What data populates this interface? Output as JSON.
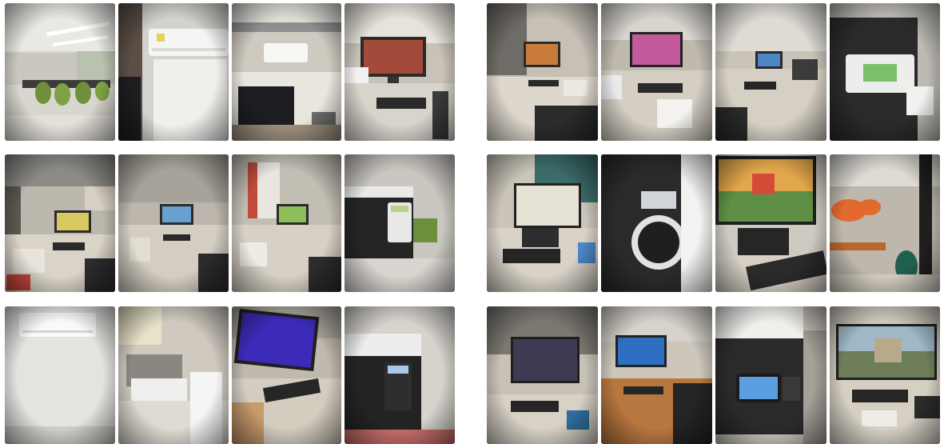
{
  "collage": {
    "left_grid": [
      {
        "id": "L-0-0",
        "subject": "conference-room"
      },
      {
        "id": "L-0-1",
        "subject": "wall-air-conditioner"
      },
      {
        "id": "L-0-2",
        "subject": "air-conditioner-and-tv"
      },
      {
        "id": "L-0-3",
        "subject": "desk-with-monitor-and-printer"
      },
      {
        "id": "L-1-0",
        "subject": "office-desk-with-monitor"
      },
      {
        "id": "L-1-1",
        "subject": "corner-desk-with-monitor"
      },
      {
        "id": "L-1-2",
        "subject": "corner-desk-with-monitor"
      },
      {
        "id": "L-1-3",
        "subject": "printer-keypad"
      },
      {
        "id": "L-2-0",
        "subject": "wall-air-conditioner"
      },
      {
        "id": "L-2-1",
        "subject": "multifunction-printer"
      },
      {
        "id": "L-2-2",
        "subject": "desk-with-blue-screen-monitor"
      },
      {
        "id": "L-2-3",
        "subject": "printer-keypad"
      }
    ],
    "right_grid": [
      {
        "id": "R-0-0",
        "subject": "l-shaped-desk-with-monitor"
      },
      {
        "id": "R-0-1",
        "subject": "desk-with-pink-screen-monitor"
      },
      {
        "id": "R-0-2",
        "subject": "desk-with-monitor"
      },
      {
        "id": "R-0-3",
        "subject": "multifunction-printer-touchscreen"
      },
      {
        "id": "R-1-0",
        "subject": "desk-with-monitor-and-keyboard"
      },
      {
        "id": "R-1-1",
        "subject": "printer-keypad-closeup"
      },
      {
        "id": "R-1-2",
        "subject": "monitor-with-castle-wallpaper"
      },
      {
        "id": "R-1-3",
        "subject": "open-office-with-orange-decor"
      },
      {
        "id": "R-2-0",
        "subject": "desk-with-monitor-by-window"
      },
      {
        "id": "R-2-1",
        "subject": "desk-with-blue-screen-monitor"
      },
      {
        "id": "R-2-2",
        "subject": "multifunction-printer-touchscreen"
      },
      {
        "id": "R-2-3",
        "subject": "monitor-with-ruins-wallpaper"
      }
    ]
  }
}
